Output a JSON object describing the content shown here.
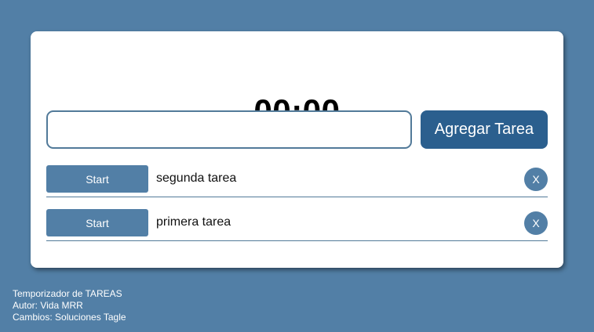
{
  "timer": {
    "display": "00:00"
  },
  "new_task": {
    "input_value": "",
    "input_placeholder": "",
    "add_button_label": "Agregar Tarea"
  },
  "tasks": [
    {
      "start_label": "Start",
      "name": "segunda tarea",
      "delete_label": "X"
    },
    {
      "start_label": "Start",
      "name": "primera tarea",
      "delete_label": "X"
    }
  ],
  "footer": {
    "line1": "Temporizador de TAREAS",
    "line2": "Autor: Vida MRR",
    "line3": "Cambios: Soluciones Tagle"
  },
  "colors": {
    "background": "#527fa6",
    "primary_button": "#2b5f8e",
    "secondary_button": "#527fa6",
    "card": "#ffffff"
  }
}
